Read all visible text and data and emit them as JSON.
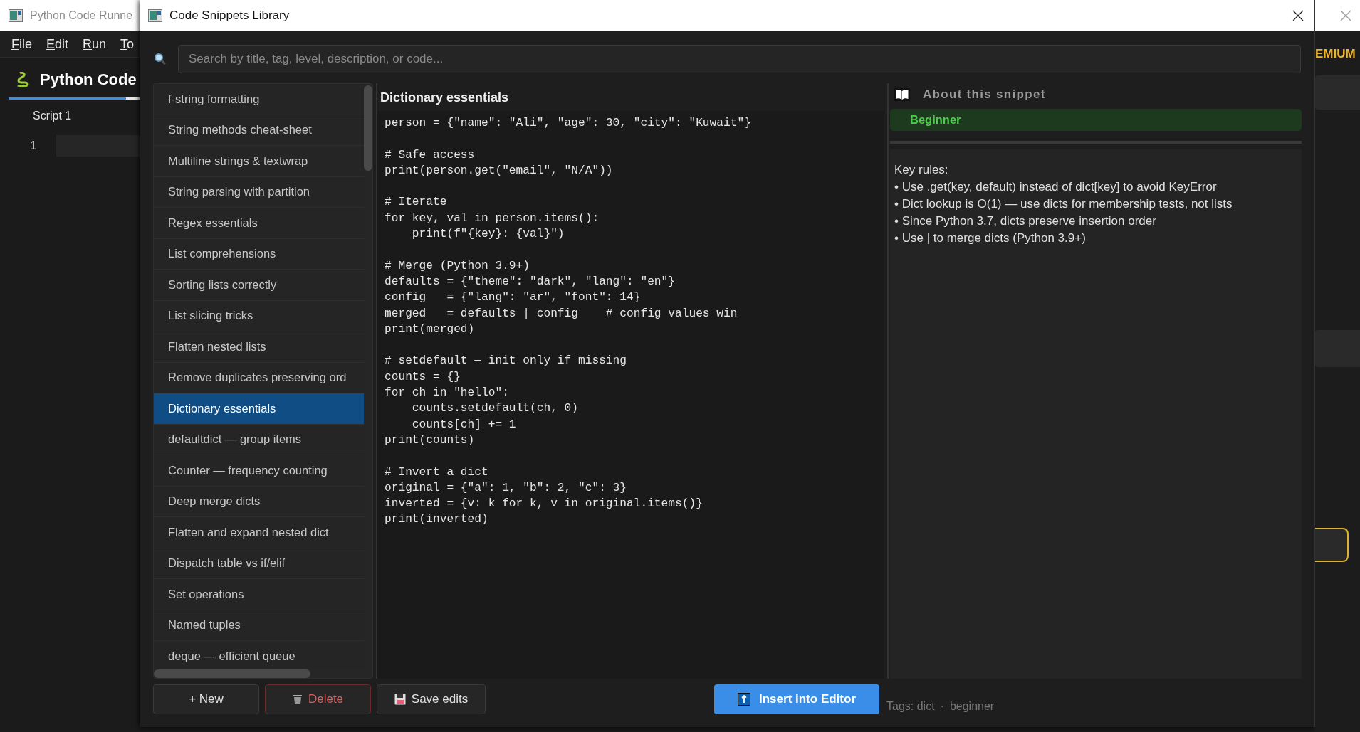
{
  "background_window": {
    "title": "Python Code Runne",
    "menu": [
      "File",
      "Edit",
      "Run",
      "To"
    ],
    "header": "Python Code",
    "tab": "Script 1",
    "line_number": "1",
    "badge": "EMIUM"
  },
  "dialog": {
    "title": "Code Snippets Library",
    "search": {
      "placeholder": "Search by title, tag, level, description, or code..."
    },
    "snippets": [
      {
        "title": "f-string formatting",
        "selected": false
      },
      {
        "title": "String methods cheat-sheet",
        "selected": false
      },
      {
        "title": "Multiline strings & textwrap",
        "selected": false
      },
      {
        "title": "String parsing with partition",
        "selected": false
      },
      {
        "title": "Regex essentials",
        "selected": false
      },
      {
        "title": "List comprehensions",
        "selected": false
      },
      {
        "title": "Sorting lists correctly",
        "selected": false
      },
      {
        "title": "List slicing tricks",
        "selected": false
      },
      {
        "title": "Flatten nested lists",
        "selected": false
      },
      {
        "title": "Remove duplicates preserving ord",
        "selected": false
      },
      {
        "title": "Dictionary essentials",
        "selected": true
      },
      {
        "title": "defaultdict — group items",
        "selected": false
      },
      {
        "title": "Counter — frequency counting",
        "selected": false
      },
      {
        "title": "Deep merge dicts",
        "selected": false
      },
      {
        "title": "Flatten and expand nested dict",
        "selected": false
      },
      {
        "title": "Dispatch table vs if/elif",
        "selected": false
      },
      {
        "title": "Set operations",
        "selected": false
      },
      {
        "title": "Named tuples",
        "selected": false
      },
      {
        "title": "deque — efficient queue",
        "selected": false
      }
    ],
    "snippet_title": "Dictionary essentials",
    "code": "person = {\"name\": \"Ali\", \"age\": 30, \"city\": \"Kuwait\"}\n\n# Safe access\nprint(person.get(\"email\", \"N/A\"))\n\n# Iterate\nfor key, val in person.items():\n    print(f\"{key}: {val}\")\n\n# Merge (Python 3.9+)\ndefaults = {\"theme\": \"dark\", \"lang\": \"en\"}\nconfig   = {\"lang\": \"ar\", \"font\": 14}\nmerged   = defaults | config    # config values win\nprint(merged)\n\n# setdefault — init only if missing\ncounts = {}\nfor ch in \"hello\":\n    counts.setdefault(ch, 0)\n    counts[ch] += 1\nprint(counts)\n\n# Invert a dict\noriginal = {\"a\": 1, \"b\": 2, \"c\": 3}\ninverted = {v: k for k, v in original.items()}\nprint(inverted)",
    "about": {
      "heading": "About this snippet",
      "level": "Beginner",
      "notes_heading": "Key rules:",
      "notes": [
        "• Use .get(key, default) instead of dict[key] to avoid KeyError",
        "• Dict lookup is O(1) — use dicts for membership tests, not lists",
        "• Since Python 3.7, dicts preserve insertion order",
        "• Use | to merge dicts (Python 3.9+)"
      ]
    },
    "buttons": [
      {
        "label": "+ New",
        "kind": "new"
      },
      {
        "label": "Delete",
        "kind": "delete"
      },
      {
        "label": "Save edits",
        "kind": "save"
      }
    ],
    "insert_button": "Insert into Editor",
    "tags": {
      "label": "Tags: dict",
      "separator": "·",
      "items": [
        "beginner"
      ]
    }
  }
}
